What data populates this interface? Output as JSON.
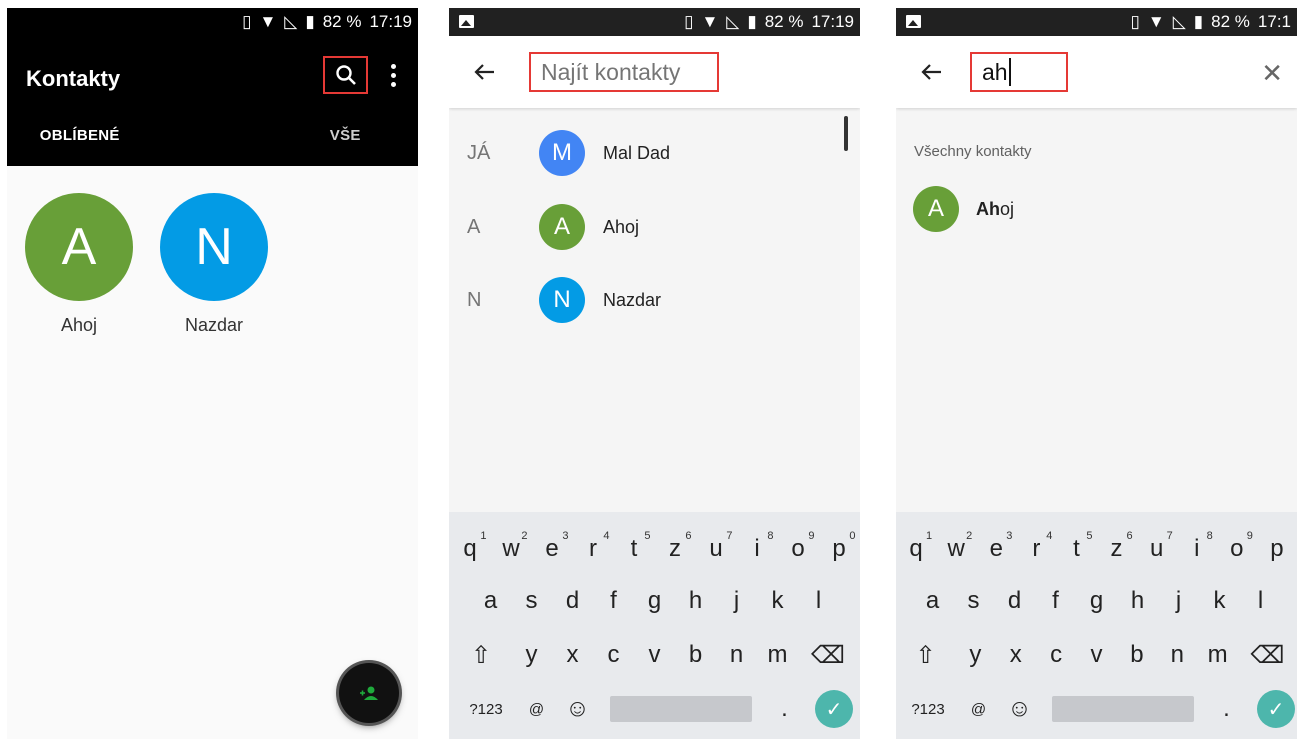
{
  "status": {
    "battery": "82 %",
    "time": "17:19",
    "time_cut": "17:1"
  },
  "screen1": {
    "title": "Kontakty",
    "tabs": [
      "OBLÍBENÉ",
      "VŠE"
    ],
    "favorites": [
      {
        "initial": "A",
        "name": "Ahoj",
        "color": "#689f38"
      },
      {
        "initial": "N",
        "name": "Nazdar",
        "color": "#039be5"
      }
    ],
    "fab_icon": "add-contact-icon"
  },
  "screen2": {
    "search_placeholder": "Najít kontakty",
    "rows": [
      {
        "section": "JÁ",
        "initial": "M",
        "name": "Mal Dad",
        "color": "#4285f4"
      },
      {
        "section": "A",
        "initial": "A",
        "name": "Ahoj",
        "color": "#689f38"
      },
      {
        "section": "N",
        "initial": "N",
        "name": "Nazdar",
        "color": "#039be5"
      }
    ]
  },
  "screen3": {
    "search_value": "ah",
    "section_header": "Všechny kontakty",
    "result": {
      "initial": "A",
      "name_bold": "Ah",
      "name_rest": "oj",
      "color": "#689f38"
    }
  },
  "keyboard": {
    "row1": [
      "q",
      "w",
      "e",
      "r",
      "t",
      "z",
      "u",
      "i",
      "o",
      "p"
    ],
    "row1_hints": [
      "1",
      "2",
      "3",
      "4",
      "5",
      "6",
      "7",
      "8",
      "9",
      "0"
    ],
    "row2": [
      "a",
      "s",
      "d",
      "f",
      "g",
      "h",
      "j",
      "k",
      "l"
    ],
    "row3": [
      "y",
      "x",
      "c",
      "v",
      "b",
      "n",
      "m"
    ],
    "shift": "⇧",
    "backspace": "⌫",
    "symbols": "?123",
    "at": "@",
    "emoji": "☺",
    "period": ".",
    "done": "✓"
  },
  "colors": {
    "highlight": "#e53935",
    "done_button": "#4db6ac"
  }
}
